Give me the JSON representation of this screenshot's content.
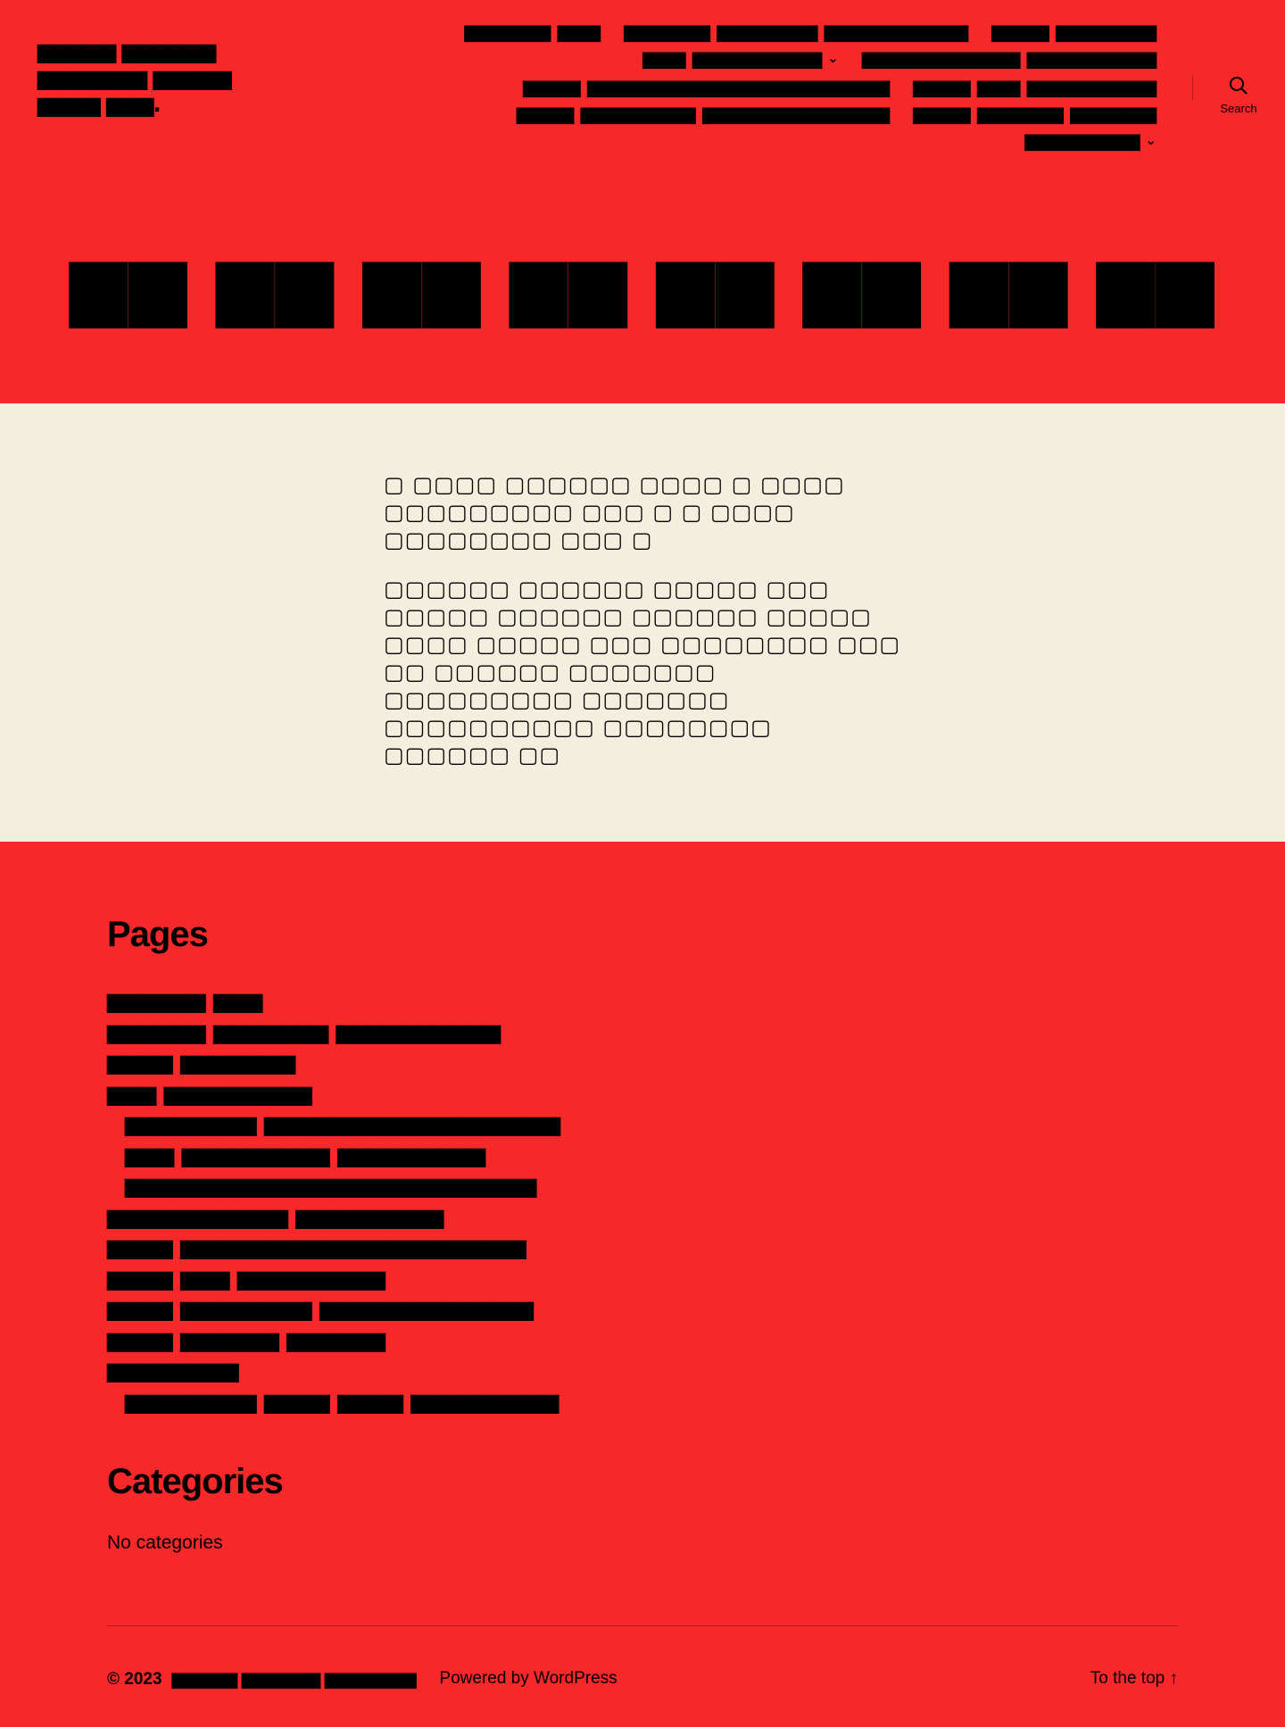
{
  "header": {
    "site_title": "▆▆▆▆▆ ▆▆▆▆▆▆ ▆▆▆▆▆▆▆ ▆▆▆▆▆ ▆▆▆▆ ▆▆▆.",
    "nav": [
      {
        "label": "▆▆▆▆▆▆ ▆▆▆",
        "has_submenu": false
      },
      {
        "label": "▆▆▆▆▆▆ ▆▆▆▆▆▆▆ ▆▆▆▆▆▆▆▆▆▆",
        "has_submenu": false
      },
      {
        "label": "▆▆▆▆ ▆▆▆▆▆▆▆",
        "has_submenu": false
      },
      {
        "label": "▆▆▆ ▆▆▆▆▆▆▆▆▆",
        "has_submenu": true
      },
      {
        "label": "▆▆▆▆▆▆▆▆▆▆▆ ▆▆▆▆▆▆▆▆▆",
        "has_submenu": false
      },
      {
        "label": "▆▆▆▆ ▆▆▆▆▆▆▆▆▆▆▆▆▆▆▆▆▆▆▆▆▆",
        "has_submenu": false
      },
      {
        "label": "▆▆▆▆ ▆▆▆ ▆▆▆▆▆▆▆▆▆",
        "has_submenu": false
      },
      {
        "label": "▆▆▆▆ ▆▆▆▆▆▆▆▆ ▆▆▆▆▆▆▆▆▆▆▆▆▆",
        "has_submenu": false
      },
      {
        "label": "▆▆▆▆ ▆▆▆▆▆▆ ▆▆▆▆▆▆",
        "has_submenu": false
      },
      {
        "label": "▆▆▆▆▆▆▆▆",
        "has_submenu": true
      }
    ],
    "search_label": "Search",
    "submenu_icon": "chevron-down-icon",
    "search_icon": "search-icon"
  },
  "page": {
    "heading": "▆▆ ▆▆ ▆▆ ▆▆ ▆▆ ▆▆ ▆▆ ▆▆"
  },
  "content": {
    "paragraphs": [
      "▢ ▢▢▢▢ ▢▢▢▢▢▢ ▢▢▢▢ ▢ ▢▢▢▢ ▢▢▢▢▢▢▢▢▢ ▢▢▢ ▢ ▢ ▢▢▢▢ ▢▢▢▢▢▢▢▢ ▢▢▢ ▢",
      "▢▢▢▢▢▢ ▢▢▢▢▢▢ ▢▢▢▢▢ ▢▢▢ ▢▢▢▢▢ ▢▢▢▢▢▢ ▢▢▢▢▢▢ ▢▢▢▢▢ ▢▢▢▢ ▢▢▢▢▢ ▢▢▢ ▢▢▢▢▢▢▢▢ ▢▢▢ ▢▢ ▢▢▢▢▢▢ ▢▢▢▢▢▢▢ ▢▢▢▢▢▢▢▢▢ ▢▢▢▢▢▢▢ ▢▢▢▢▢▢▢▢▢▢ ▢▢▢▢▢▢▢▢ ▢▢▢▢▢▢ ▢▢"
    ]
  },
  "widgets": {
    "pages_title": "Pages",
    "pages": [
      {
        "label": "▆▆▆▆▆▆ ▆▆▆",
        "child": false
      },
      {
        "label": "▆▆▆▆▆▆ ▆▆▆▆▆▆▆ ▆▆▆▆▆▆▆▆▆▆",
        "child": false
      },
      {
        "label": "▆▆▆▆ ▆▆▆▆▆▆▆",
        "child": false
      },
      {
        "label": "▆▆▆ ▆▆▆▆▆▆▆▆▆",
        "child": false
      },
      {
        "label": "▆▆▆▆▆▆▆▆ ▆▆▆▆▆▆▆▆▆▆▆▆▆▆▆▆▆▆",
        "child": true
      },
      {
        "label": "▆▆▆ ▆▆▆▆▆▆▆▆▆ ▆▆▆▆▆▆▆▆▆",
        "child": true
      },
      {
        "label": "▆▆▆▆▆▆▆▆▆▆▆▆▆▆▆▆▆▆▆▆▆▆▆▆▆",
        "child": true
      },
      {
        "label": "▆▆▆▆▆▆▆▆▆▆▆ ▆▆▆▆▆▆▆▆▆",
        "child": false
      },
      {
        "label": "▆▆▆▆ ▆▆▆▆▆▆▆▆▆▆▆▆▆▆▆▆▆▆▆▆▆",
        "child": false
      },
      {
        "label": "▆▆▆▆ ▆▆▆ ▆▆▆▆▆▆▆▆▆",
        "child": false
      },
      {
        "label": "▆▆▆▆ ▆▆▆▆▆▆▆▆ ▆▆▆▆▆▆▆▆▆▆▆▆▆",
        "child": false
      },
      {
        "label": "▆▆▆▆ ▆▆▆▆▆▆ ▆▆▆▆▆▆",
        "child": false
      },
      {
        "label": "▆▆▆▆▆▆▆▆",
        "child": false
      },
      {
        "label": "▆▆▆▆▆▆▆▆ ▆▆▆▆ ▆▆▆▆ ▆▆▆▆▆▆▆▆▆",
        "child": true
      }
    ],
    "categories_title": "Categories",
    "categories_empty": "No categories"
  },
  "footer": {
    "copyright_prefix": "© 2023",
    "copyright_site": "▆▆▆▆▆ ▆▆▆▆▆▆ ▆▆▆▆▆▆▆",
    "powered_by": "Powered by WordPress",
    "to_top": "To the top ↑"
  },
  "colors": {
    "primary_bg": "#f72829",
    "content_bg": "#f4eedf",
    "text": "#000000"
  }
}
